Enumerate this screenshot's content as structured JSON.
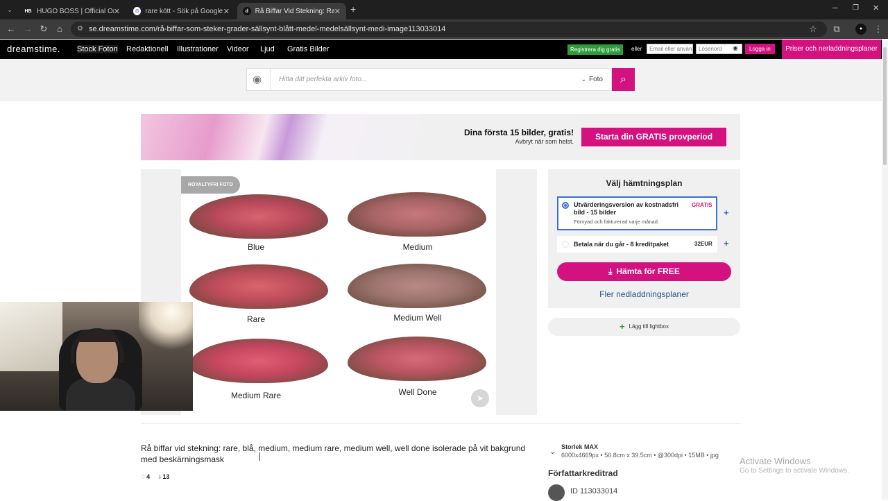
{
  "browser": {
    "tabs": [
      {
        "favicon": "HB",
        "title": "HUGO BOSS | Official Online Sh",
        "close": "✕"
      },
      {
        "favicon": "G",
        "title": "rare kött - Sök på Google",
        "close": "✕"
      },
      {
        "favicon": "d",
        "title": "Rå Biffar Vid Stekning: Rare, Blå",
        "close": "✕"
      }
    ],
    "new_tab": "+",
    "url": "se.dreamstime.com/rå-biffar-som-steker-grader-sällsynt-blått-medel-medelsällsynt-medi-image113033014"
  },
  "site": {
    "logo": "dreamstime.",
    "nav": [
      "Stock Foton",
      "Redaktionell",
      "Illustrationer",
      "Videor",
      "Ljud",
      "Gratis Bilder"
    ],
    "register": "Registrera dig gratis",
    "or": "eller",
    "email_placeholder": "Email eller använ",
    "password_placeholder": "Lösenord",
    "login": "Logga in",
    "pricing": "Priser och nerladdningsplaner"
  },
  "search": {
    "placeholder": "Hitta ditt perfekta arkiv foto...",
    "type": "Foto"
  },
  "banner": {
    "title": "Dina första 15 bilder, gratis!",
    "subtitle": "Avbryt när som helst.",
    "cta": "Starta din GRATIS provperiod"
  },
  "image": {
    "badge": "ROYALTYFRI FOTO",
    "labels": [
      "Blue",
      "Medium",
      "Rare",
      "Medium Well",
      "Medium Rare",
      "Well Done"
    ]
  },
  "plan": {
    "title": "Välj hämtningsplan",
    "option1": {
      "title": "Utvärderingsversion av kostnadsfri bild - 15 bilder",
      "subtitle": "Förnyad och fakturerad varje månad.",
      "price": "GRATIS"
    },
    "option2": {
      "title": "Betala när du går - 8 kreditpaket",
      "price": "32EUR"
    },
    "plus": "+",
    "download": "Hämta för FREE",
    "more": "Fler nedladdningsplaner",
    "lightbox": "Lägg till lightbox"
  },
  "details": {
    "description": "Rå biffar vid stekning: rare, blå, medium, medium rare, medium well, well done isolerade på vit bakgrund med beskärningsmask",
    "likes": "4",
    "downloads": "13",
    "size_title": "Storlek MAX",
    "size_value": "6000x4669px • 50.8cm x 39.5cm • @300dpi • 15MB • jpg",
    "author_credit": "Författarkreditrad",
    "id": "ID 113033014"
  },
  "os": {
    "activate_title": "Activate Windows",
    "activate_sub": "Go to Settings to activate Windows."
  },
  "colors": {
    "brand": "#d3117f",
    "register_green": "#2e9c3b",
    "link_blue": "#2a4f8c"
  }
}
